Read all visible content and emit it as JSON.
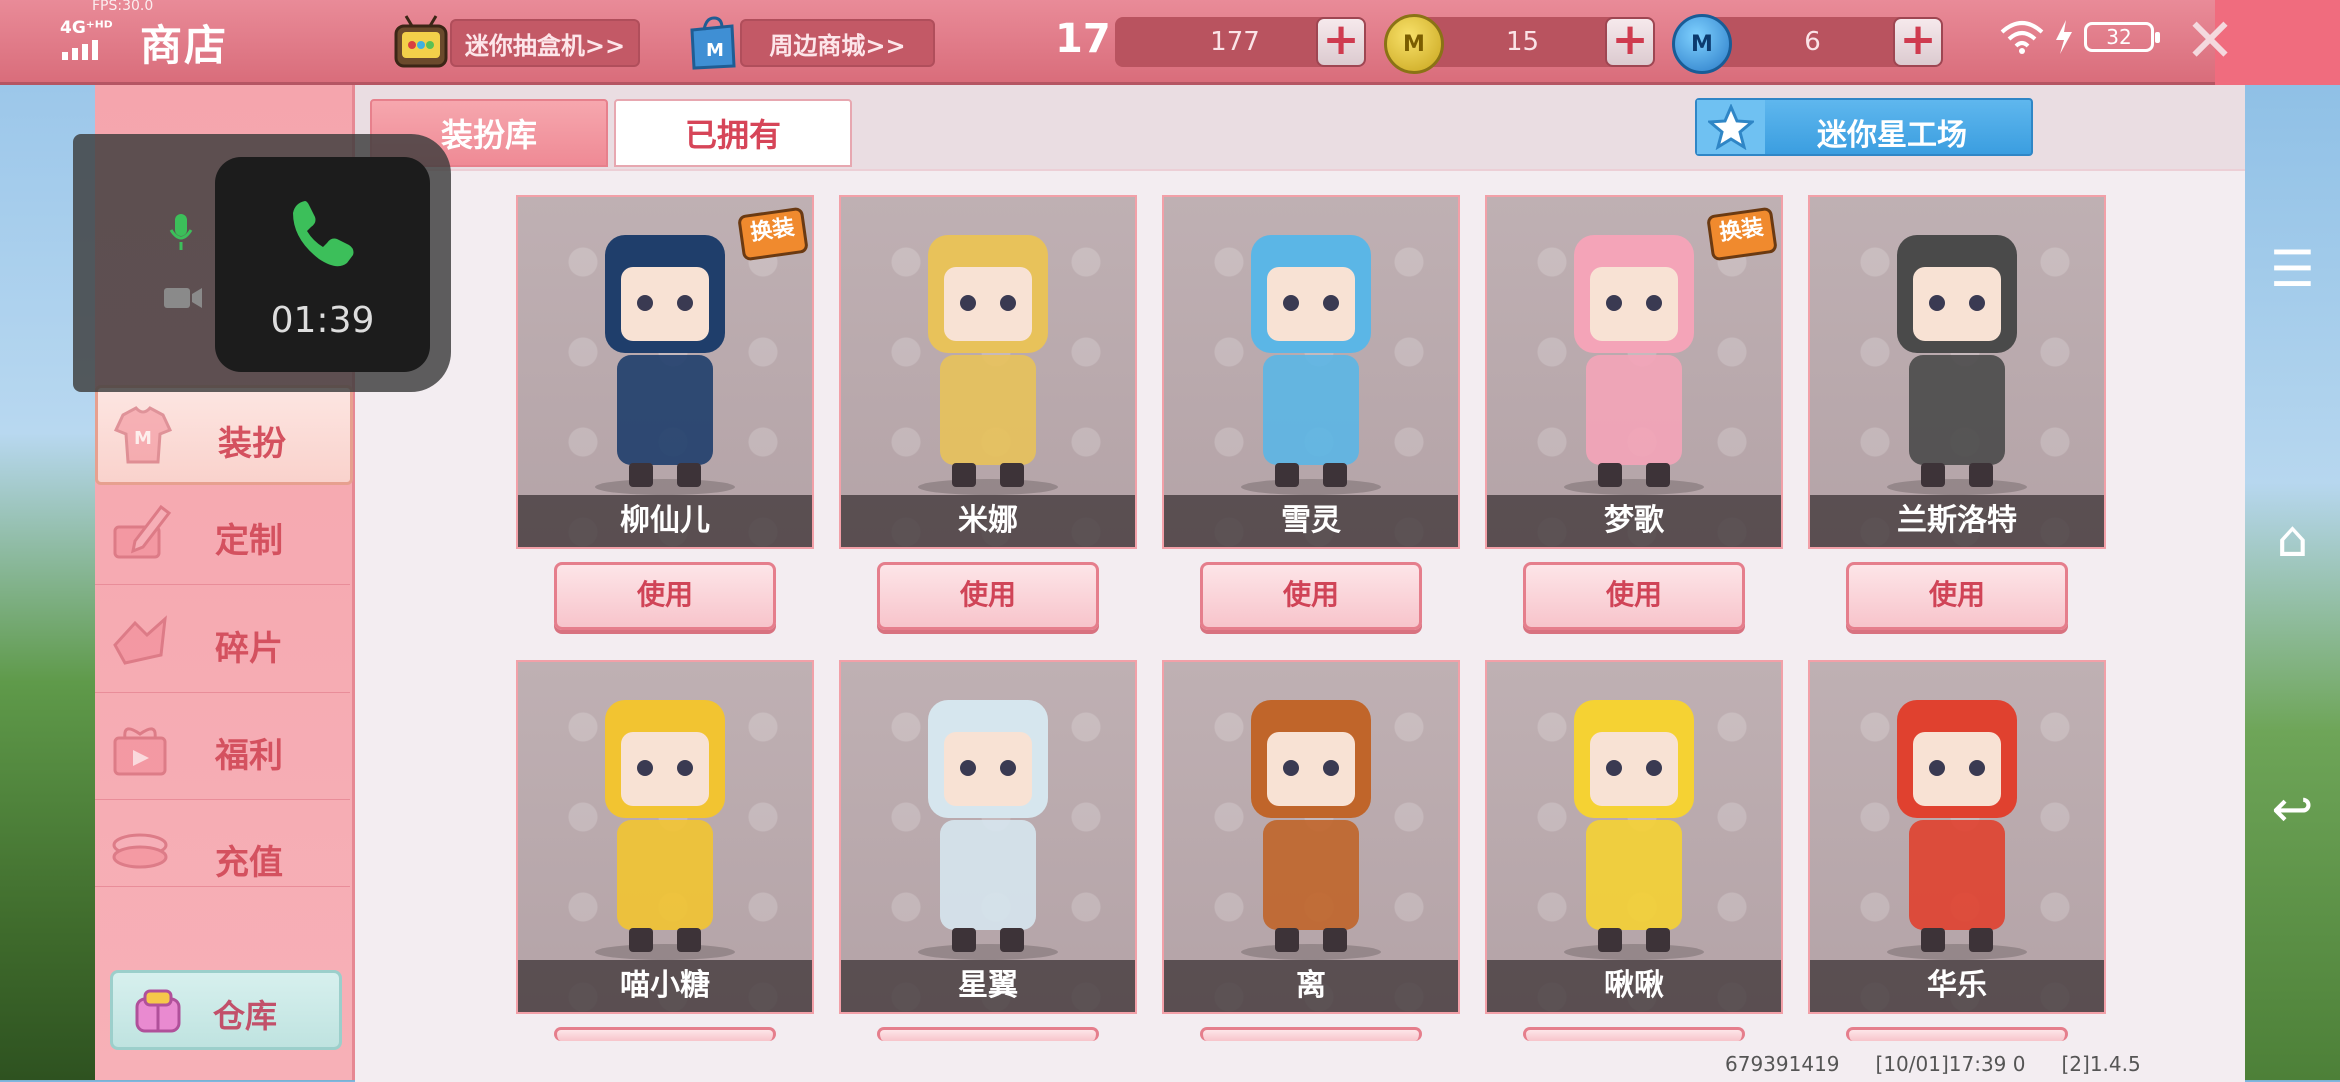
{
  "status": {
    "fps": "FPS:30.0",
    "network": "4G⁺ᴴᴰ",
    "clock": "17:39",
    "battery": "32"
  },
  "header": {
    "title": "商店",
    "blind_box_link": "迷你抽盒机>>",
    "merch_link": "周边商城>>",
    "currency_1": "177",
    "currency_2": "15",
    "currency_3": "6",
    "coin_gold_symbol": "M",
    "coin_blue_symbol": "M",
    "plus_label": "+",
    "close_label": "✕"
  },
  "call": {
    "duration": "01:39"
  },
  "sidebar": {
    "items": [
      {
        "label": "装扮",
        "icon": "shirt-icon",
        "active": true
      },
      {
        "label": "定制",
        "icon": "pencil-icon",
        "active": false
      },
      {
        "label": "碎片",
        "icon": "fragment-icon",
        "active": false
      },
      {
        "label": "福利",
        "icon": "gift-icon",
        "active": false
      },
      {
        "label": "充值",
        "icon": "coins-icon",
        "active": false
      }
    ],
    "warehouse_label": "仓库"
  },
  "tabs": {
    "dress_library": "装扮库",
    "owned": "已拥有",
    "workshop": "迷你星工场"
  },
  "skins": [
    {
      "name": "柳仙儿",
      "badge": "换装",
      "use_label": "使用",
      "color": "#1f3e6b"
    },
    {
      "name": "米娜",
      "badge": "",
      "use_label": "使用",
      "color": "#e8c25a"
    },
    {
      "name": "雪灵",
      "badge": "",
      "use_label": "使用",
      "color": "#5bb6e6"
    },
    {
      "name": "梦歌",
      "badge": "换装",
      "use_label": "使用",
      "color": "#f4a4b8"
    },
    {
      "name": "兰斯洛特",
      "badge": "",
      "use_label": "使用",
      "color": "#4a4a4a"
    },
    {
      "name": "喵小糖",
      "badge": "",
      "use_label": "",
      "color": "#f2c431"
    },
    {
      "name": "星翼",
      "badge": "",
      "use_label": "",
      "color": "#d6e6ee"
    },
    {
      "name": "离",
      "badge": "",
      "use_label": "",
      "color": "#c0652a"
    },
    {
      "name": "啾啾",
      "badge": "",
      "use_label": "",
      "color": "#f5d233"
    },
    {
      "name": "华乐",
      "badge": "",
      "use_label": "",
      "color": "#e0412f"
    }
  ],
  "footer": {
    "user_id": "679391419",
    "timestamp": "[10/01]17:39 0",
    "version": "[2]1.4.5"
  },
  "nav": {
    "menu": "☰",
    "home": "⌂",
    "back": "↩"
  }
}
